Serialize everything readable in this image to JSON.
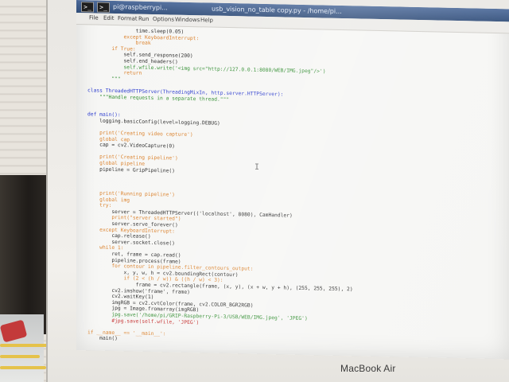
{
  "taskbar": {
    "items": [
      "pi@raspberrypi...",
      "usb_vision_no_table copy.py - /home/pi..."
    ],
    "terminal_icon_glyph": ">_"
  },
  "menubar": {
    "items": [
      "File",
      "Edit",
      "Format",
      "Run",
      "Options",
      "Windows",
      "Help"
    ]
  },
  "code_lines": [
    {
      "t": "                time.sleep(0.05)",
      "c": ""
    },
    {
      "t": "            except KeyboardInterrupt:",
      "c": "kw"
    },
    {
      "t": "                break",
      "c": "kw"
    },
    {
      "t": "        if True:",
      "c": "kw"
    },
    {
      "t": "            self.send_response(200)",
      "c": ""
    },
    {
      "t": "            self.end_headers()",
      "c": ""
    },
    {
      "t": "            self.wfile.write('<img src=\"http://127.0.0.1:8080/WEB/IMG.jpeg\"/>')",
      "c": "str"
    },
    {
      "t": "            return",
      "c": "kw"
    },
    {
      "t": "        \"\"\"",
      "c": "str"
    },
    {
      "t": "",
      "c": ""
    },
    {
      "t": "class ThreadedHTTPServer(ThreadingMixIn, http.server.HTTPServer):",
      "c": "fn"
    },
    {
      "t": "    \"\"\"Handle requests in a separate thread.\"\"\"",
      "c": "str"
    },
    {
      "t": "",
      "c": ""
    },
    {
      "t": "",
      "c": ""
    },
    {
      "t": "def main():",
      "c": "fn"
    },
    {
      "t": "    logging.basicConfig(level=logging.DEBUG)",
      "c": ""
    },
    {
      "t": "",
      "c": ""
    },
    {
      "t": "    print('Creating video capture')",
      "c": "kw"
    },
    {
      "t": "    global cap",
      "c": "kw"
    },
    {
      "t": "    cap = cv2.VideoCapture(0)",
      "c": ""
    },
    {
      "t": "",
      "c": ""
    },
    {
      "t": "    print('Creating pipeline')",
      "c": "kw"
    },
    {
      "t": "    global pipeline",
      "c": "kw"
    },
    {
      "t": "    pipeline = GripPipeline()",
      "c": ""
    },
    {
      "t": "",
      "c": ""
    },
    {
      "t": "",
      "c": ""
    },
    {
      "t": "",
      "c": ""
    },
    {
      "t": "    print('Running pipeline')",
      "c": "kw"
    },
    {
      "t": "    global img",
      "c": "kw"
    },
    {
      "t": "    try:",
      "c": "kw"
    },
    {
      "t": "        server = ThreadedHTTPServer(('localhost', 8080), CamHandler)",
      "c": ""
    },
    {
      "t": "        print(\"server started\")",
      "c": "kw"
    },
    {
      "t": "        server.serve_forever()",
      "c": ""
    },
    {
      "t": "    except KeyboardInterrupt:",
      "c": "kw"
    },
    {
      "t": "        cap.release()",
      "c": ""
    },
    {
      "t": "        server.socket.close()",
      "c": ""
    },
    {
      "t": "    while 1:",
      "c": "kw"
    },
    {
      "t": "        ret, frame = cap.read()",
      "c": ""
    },
    {
      "t": "        pipeline.process(frame)",
      "c": ""
    },
    {
      "t": "        for contour in pipeline.filter_contours_output:",
      "c": "kw"
    },
    {
      "t": "            x, y, w, h = cv2.boundingRect(contour)",
      "c": ""
    },
    {
      "t": "            if (2 < (h / w)) & ((h / w) < 3):",
      "c": "kw"
    },
    {
      "t": "                frame = cv2.rectangle(frame, (x, y), (x + w, y + h), (255, 255, 255), 2)",
      "c": ""
    },
    {
      "t": "        cv2.imshow('frame', frame)",
      "c": ""
    },
    {
      "t": "        cv2.waitKey(1)",
      "c": ""
    },
    {
      "t": "        imgRGB = cv2.cvtColor(frame, cv2.COLOR_BGR2RGB)",
      "c": ""
    },
    {
      "t": "        jpg = Image.fromarray(imgRGB)",
      "c": ""
    },
    {
      "t": "        jpg.save('/home/pi/GRIP-Raspberry-Pi-3/USB/WEB/IMG.jpeg', 'JPEG')",
      "c": "str"
    },
    {
      "t": "        #jpg.save(self.wfile, 'JPEG')",
      "c": "cm"
    },
    {
      "t": "",
      "c": ""
    },
    {
      "t": "if __name__ == '__main__':",
      "c": "kw"
    },
    {
      "t": "    main()",
      "c": ""
    }
  ],
  "laptop_brand": "MacBook Air",
  "colors": {
    "keyword": "#d97a1f",
    "string": "#2a8a2a",
    "definition": "#2233cc",
    "comment": "#c02020",
    "taskbar": "#2f4c78"
  }
}
